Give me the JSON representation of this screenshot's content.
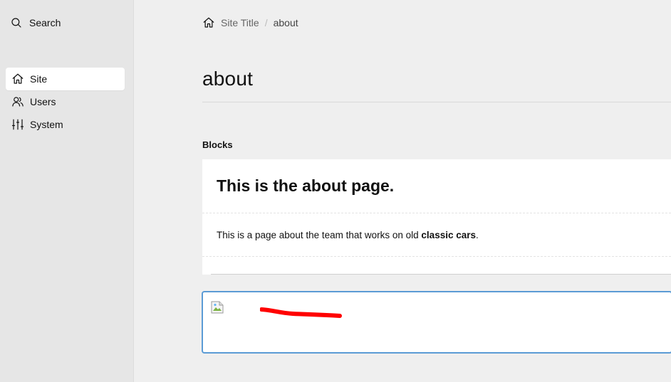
{
  "sidebar": {
    "search_label": "Search",
    "items": [
      {
        "label": "Site",
        "icon": "home-icon",
        "active": true
      },
      {
        "label": "Users",
        "icon": "users-icon",
        "active": false
      },
      {
        "label": "System",
        "icon": "sliders-icon",
        "active": false
      }
    ]
  },
  "breadcrumb": {
    "home_icon": "home-icon",
    "site_title": "Site Title",
    "separator": "/",
    "current": "about"
  },
  "page": {
    "title": "about",
    "blocks_label": "Blocks"
  },
  "blocks": {
    "heading": "This is the about page.",
    "paragraph_prefix": "This is a page about the team that works on old ",
    "paragraph_bold": "classic cars",
    "paragraph_suffix": "."
  },
  "colors": {
    "accent_border": "#5b9bd5",
    "scribble": "#ff0000",
    "sidebar_bg": "#e6e6e6",
    "main_bg": "#efefef"
  }
}
